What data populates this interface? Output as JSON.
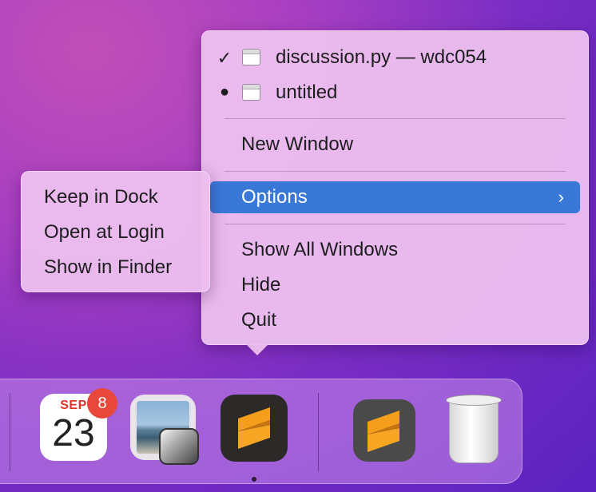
{
  "dock_menu": {
    "windows": [
      {
        "marker": "✓",
        "label": "discussion.py — wdc054"
      },
      {
        "marker": "●",
        "label": "untitled"
      }
    ],
    "new_window": "New Window",
    "options": "Options",
    "options_chevron": "›",
    "show_all_windows": "Show All Windows",
    "hide": "Hide",
    "quit": "Quit"
  },
  "options_submenu": {
    "keep_in_dock": "Keep in Dock",
    "open_at_login": "Open at Login",
    "show_in_finder": "Show in Finder"
  },
  "dock": {
    "calendar": {
      "month": "SEP",
      "day": "23",
      "badge": "8"
    },
    "apps": [
      "calendar-icon",
      "preview-icon",
      "sublime-text-icon",
      "sublime-text-folder-icon",
      "trash-icon"
    ],
    "highlight_color": "#3a78d8"
  }
}
